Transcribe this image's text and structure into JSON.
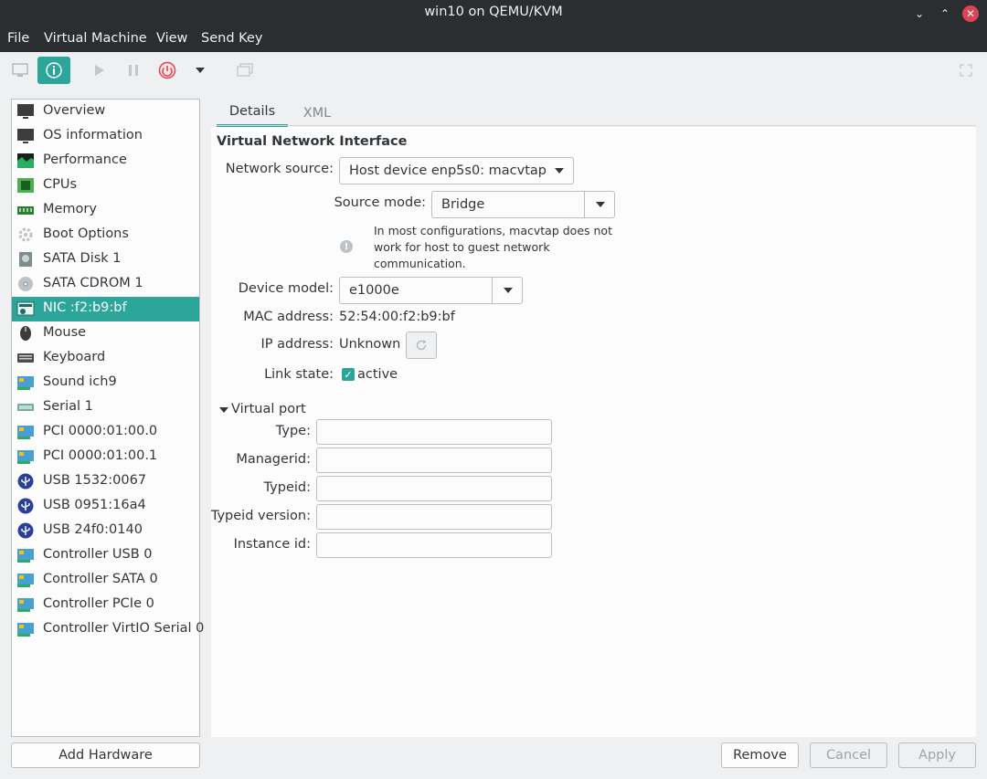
{
  "window": {
    "title": "win10 on QEMU/KVM"
  },
  "menu": [
    "File",
    "Virtual Machine",
    "View",
    "Send Key"
  ],
  "toolbar": {
    "buttons": [
      "monitor-icon",
      "info-icon",
      "play-icon",
      "pause-icon",
      "power-icon",
      "dropdown-icon",
      "snapshot-icon",
      "fullscreen-icon"
    ]
  },
  "sidebar": {
    "items": [
      {
        "label": "Overview",
        "icon": "monitor-icon",
        "color": "#3c3c3c"
      },
      {
        "label": "OS information",
        "icon": "monitor-icon",
        "color": "#3c3c3c"
      },
      {
        "label": "Performance",
        "icon": "chart-icon",
        "color": "#27ae60"
      },
      {
        "label": "CPUs",
        "icon": "cpu-icon",
        "color": "#4caf50"
      },
      {
        "label": "Memory",
        "icon": "memory-icon",
        "color": "#2e7d32"
      },
      {
        "label": "Boot Options",
        "icon": "gear-icon",
        "color": "#bdc3c7"
      },
      {
        "label": "SATA Disk 1",
        "icon": "disk-icon",
        "color": "#7f8c8d"
      },
      {
        "label": "SATA CDROM 1",
        "icon": "cdrom-icon",
        "color": "#bdc3c7"
      },
      {
        "label": "NIC :f2:b9:bf",
        "icon": "network-card-icon",
        "color": "#1d6b63"
      },
      {
        "label": "Mouse",
        "icon": "mouse-icon",
        "color": "#3c3c3c"
      },
      {
        "label": "Keyboard",
        "icon": "keyboard-icon",
        "color": "#4d4d4d"
      },
      {
        "label": "Sound ich9",
        "icon": "pci-card-icon",
        "color": "#4a9fd1"
      },
      {
        "label": "Serial 1",
        "icon": "serial-icon",
        "color": "#7fa7a3"
      },
      {
        "label": "PCI 0000:01:00.0",
        "icon": "pci-card-icon",
        "color": "#4a9fd1"
      },
      {
        "label": "PCI 0000:01:00.1",
        "icon": "pci-card-icon",
        "color": "#4a9fd1"
      },
      {
        "label": "USB 1532:0067",
        "icon": "usb-icon",
        "color": "#2a3f97"
      },
      {
        "label": "USB 0951:16a4",
        "icon": "usb-icon",
        "color": "#2a3f97"
      },
      {
        "label": "USB 24f0:0140",
        "icon": "usb-icon",
        "color": "#2a3f97"
      },
      {
        "label": "Controller USB 0",
        "icon": "pci-card-icon",
        "color": "#4a9fd1"
      },
      {
        "label": "Controller SATA 0",
        "icon": "pci-card-icon",
        "color": "#4a9fd1"
      },
      {
        "label": "Controller PCIe 0",
        "icon": "pci-card-icon",
        "color": "#4a9fd1"
      },
      {
        "label": "Controller VirtIO Serial 0",
        "icon": "pci-card-icon",
        "color": "#4a9fd1"
      }
    ],
    "selected": "NIC :f2:b9:bf",
    "add_hardware": "Add Hardware"
  },
  "tabs": [
    "Details",
    "XML"
  ],
  "details": {
    "section_title": "Virtual Network Interface",
    "network_source_label": "Network source:",
    "network_source_value": "Host device enp5s0: macvtap",
    "source_mode_label": "Source mode:",
    "source_mode_value": "Bridge",
    "note": [
      "In most configurations, macvtap does not",
      "work for host to guest network",
      "communication."
    ],
    "device_model_label": "Device model:",
    "device_model_value": "e1000e",
    "mac_label": "MAC address:",
    "mac_value": "52:54:00:f2:b9:bf",
    "ip_label": "IP address:",
    "ip_value": "Unknown",
    "link_label": "Link state:",
    "link_value": "active",
    "virtual_port_title": "Virtual port",
    "vp_fields": [
      "Type:",
      "Managerid:",
      "Typeid:",
      "Typeid version:",
      "Instance id:"
    ]
  },
  "actions": {
    "remove": "Remove",
    "cancel": "Cancel",
    "apply": "Apply"
  },
  "colors": {
    "accent": "#2ca69a",
    "titlebar": "#2b2e31",
    "close": "#da4453"
  }
}
